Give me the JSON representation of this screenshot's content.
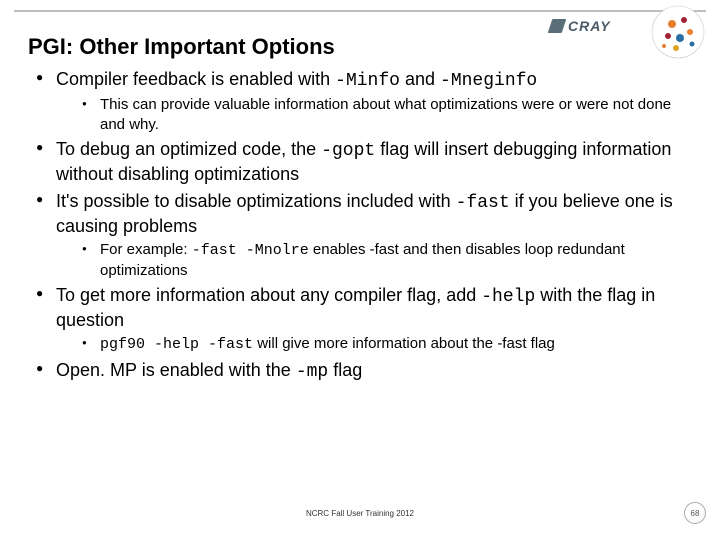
{
  "brand": "CRAY",
  "title": "PGI: Other Important Options",
  "b1": {
    "pre": "Compiler feedback is enabled with ",
    "code1": "-Minfo",
    "mid": " and ",
    "code2": "-Mneginfo",
    "sub": "This can provide valuable information about what optimizations were or were not done and why."
  },
  "b2": {
    "pre": "To debug an optimized code, the ",
    "code": "-gopt",
    "post": " flag will insert debugging information without disabling optimizations"
  },
  "b3": {
    "pre": "It's possible to disable optimizations included with ",
    "code": "-fast",
    "post": " if you believe one is causing problems",
    "sub_pre": "For example: ",
    "sub_code": "-fast -Mnolre",
    "sub_post": " enables -fast and then disables loop redundant optimizations"
  },
  "b4": {
    "pre": "To get more information about any compiler flag, add ",
    "code": "-help",
    "post": " with the flag in question",
    "sub_code": "pgf90 -help -fast",
    "sub_post": " will give more information about the -fast flag"
  },
  "b5": {
    "pre": "Open. MP is enabled with the ",
    "code": "-mp",
    "post": " flag"
  },
  "footer": "NCRC Fall User Training 2012",
  "page": "68"
}
